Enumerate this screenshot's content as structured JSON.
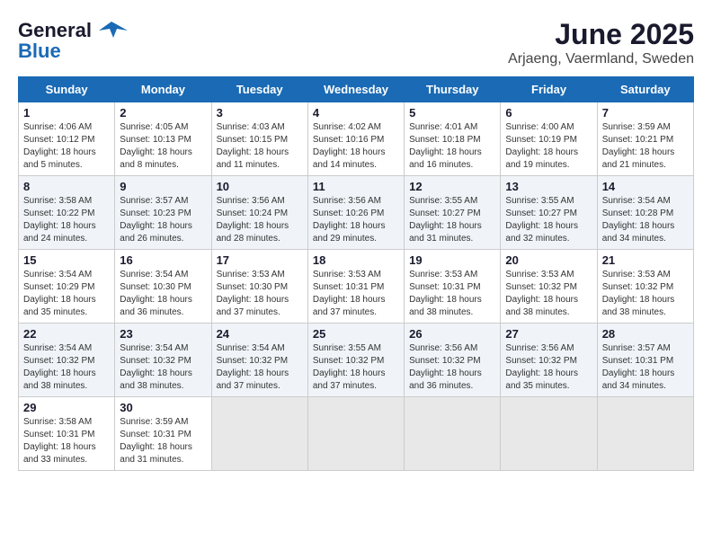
{
  "header": {
    "logo_general": "General",
    "logo_blue": "Blue",
    "month_year": "June 2025",
    "location": "Arjaeng, Vaermland, Sweden"
  },
  "days_of_week": [
    "Sunday",
    "Monday",
    "Tuesday",
    "Wednesday",
    "Thursday",
    "Friday",
    "Saturday"
  ],
  "weeks": [
    [
      {
        "day": "1",
        "sunrise": "Sunrise: 4:06 AM",
        "sunset": "Sunset: 10:12 PM",
        "daylight": "Daylight: 18 hours and 5 minutes."
      },
      {
        "day": "2",
        "sunrise": "Sunrise: 4:05 AM",
        "sunset": "Sunset: 10:13 PM",
        "daylight": "Daylight: 18 hours and 8 minutes."
      },
      {
        "day": "3",
        "sunrise": "Sunrise: 4:03 AM",
        "sunset": "Sunset: 10:15 PM",
        "daylight": "Daylight: 18 hours and 11 minutes."
      },
      {
        "day": "4",
        "sunrise": "Sunrise: 4:02 AM",
        "sunset": "Sunset: 10:16 PM",
        "daylight": "Daylight: 18 hours and 14 minutes."
      },
      {
        "day": "5",
        "sunrise": "Sunrise: 4:01 AM",
        "sunset": "Sunset: 10:18 PM",
        "daylight": "Daylight: 18 hours and 16 minutes."
      },
      {
        "day": "6",
        "sunrise": "Sunrise: 4:00 AM",
        "sunset": "Sunset: 10:19 PM",
        "daylight": "Daylight: 18 hours and 19 minutes."
      },
      {
        "day": "7",
        "sunrise": "Sunrise: 3:59 AM",
        "sunset": "Sunset: 10:21 PM",
        "daylight": "Daylight: 18 hours and 21 minutes."
      }
    ],
    [
      {
        "day": "8",
        "sunrise": "Sunrise: 3:58 AM",
        "sunset": "Sunset: 10:22 PM",
        "daylight": "Daylight: 18 hours and 24 minutes."
      },
      {
        "day": "9",
        "sunrise": "Sunrise: 3:57 AM",
        "sunset": "Sunset: 10:23 PM",
        "daylight": "Daylight: 18 hours and 26 minutes."
      },
      {
        "day": "10",
        "sunrise": "Sunrise: 3:56 AM",
        "sunset": "Sunset: 10:24 PM",
        "daylight": "Daylight: 18 hours and 28 minutes."
      },
      {
        "day": "11",
        "sunrise": "Sunrise: 3:56 AM",
        "sunset": "Sunset: 10:26 PM",
        "daylight": "Daylight: 18 hours and 29 minutes."
      },
      {
        "day": "12",
        "sunrise": "Sunrise: 3:55 AM",
        "sunset": "Sunset: 10:27 PM",
        "daylight": "Daylight: 18 hours and 31 minutes."
      },
      {
        "day": "13",
        "sunrise": "Sunrise: 3:55 AM",
        "sunset": "Sunset: 10:27 PM",
        "daylight": "Daylight: 18 hours and 32 minutes."
      },
      {
        "day": "14",
        "sunrise": "Sunrise: 3:54 AM",
        "sunset": "Sunset: 10:28 PM",
        "daylight": "Daylight: 18 hours and 34 minutes."
      }
    ],
    [
      {
        "day": "15",
        "sunrise": "Sunrise: 3:54 AM",
        "sunset": "Sunset: 10:29 PM",
        "daylight": "Daylight: 18 hours and 35 minutes."
      },
      {
        "day": "16",
        "sunrise": "Sunrise: 3:54 AM",
        "sunset": "Sunset: 10:30 PM",
        "daylight": "Daylight: 18 hours and 36 minutes."
      },
      {
        "day": "17",
        "sunrise": "Sunrise: 3:53 AM",
        "sunset": "Sunset: 10:30 PM",
        "daylight": "Daylight: 18 hours and 37 minutes."
      },
      {
        "day": "18",
        "sunrise": "Sunrise: 3:53 AM",
        "sunset": "Sunset: 10:31 PM",
        "daylight": "Daylight: 18 hours and 37 minutes."
      },
      {
        "day": "19",
        "sunrise": "Sunrise: 3:53 AM",
        "sunset": "Sunset: 10:31 PM",
        "daylight": "Daylight: 18 hours and 38 minutes."
      },
      {
        "day": "20",
        "sunrise": "Sunrise: 3:53 AM",
        "sunset": "Sunset: 10:32 PM",
        "daylight": "Daylight: 18 hours and 38 minutes."
      },
      {
        "day": "21",
        "sunrise": "Sunrise: 3:53 AM",
        "sunset": "Sunset: 10:32 PM",
        "daylight": "Daylight: 18 hours and 38 minutes."
      }
    ],
    [
      {
        "day": "22",
        "sunrise": "Sunrise: 3:54 AM",
        "sunset": "Sunset: 10:32 PM",
        "daylight": "Daylight: 18 hours and 38 minutes."
      },
      {
        "day": "23",
        "sunrise": "Sunrise: 3:54 AM",
        "sunset": "Sunset: 10:32 PM",
        "daylight": "Daylight: 18 hours and 38 minutes."
      },
      {
        "day": "24",
        "sunrise": "Sunrise: 3:54 AM",
        "sunset": "Sunset: 10:32 PM",
        "daylight": "Daylight: 18 hours and 37 minutes."
      },
      {
        "day": "25",
        "sunrise": "Sunrise: 3:55 AM",
        "sunset": "Sunset: 10:32 PM",
        "daylight": "Daylight: 18 hours and 37 minutes."
      },
      {
        "day": "26",
        "sunrise": "Sunrise: 3:56 AM",
        "sunset": "Sunset: 10:32 PM",
        "daylight": "Daylight: 18 hours and 36 minutes."
      },
      {
        "day": "27",
        "sunrise": "Sunrise: 3:56 AM",
        "sunset": "Sunset: 10:32 PM",
        "daylight": "Daylight: 18 hours and 35 minutes."
      },
      {
        "day": "28",
        "sunrise": "Sunrise: 3:57 AM",
        "sunset": "Sunset: 10:31 PM",
        "daylight": "Daylight: 18 hours and 34 minutes."
      }
    ],
    [
      {
        "day": "29",
        "sunrise": "Sunrise: 3:58 AM",
        "sunset": "Sunset: 10:31 PM",
        "daylight": "Daylight: 18 hours and 33 minutes."
      },
      {
        "day": "30",
        "sunrise": "Sunrise: 3:59 AM",
        "sunset": "Sunset: 10:31 PM",
        "daylight": "Daylight: 18 hours and 31 minutes."
      },
      null,
      null,
      null,
      null,
      null
    ]
  ]
}
